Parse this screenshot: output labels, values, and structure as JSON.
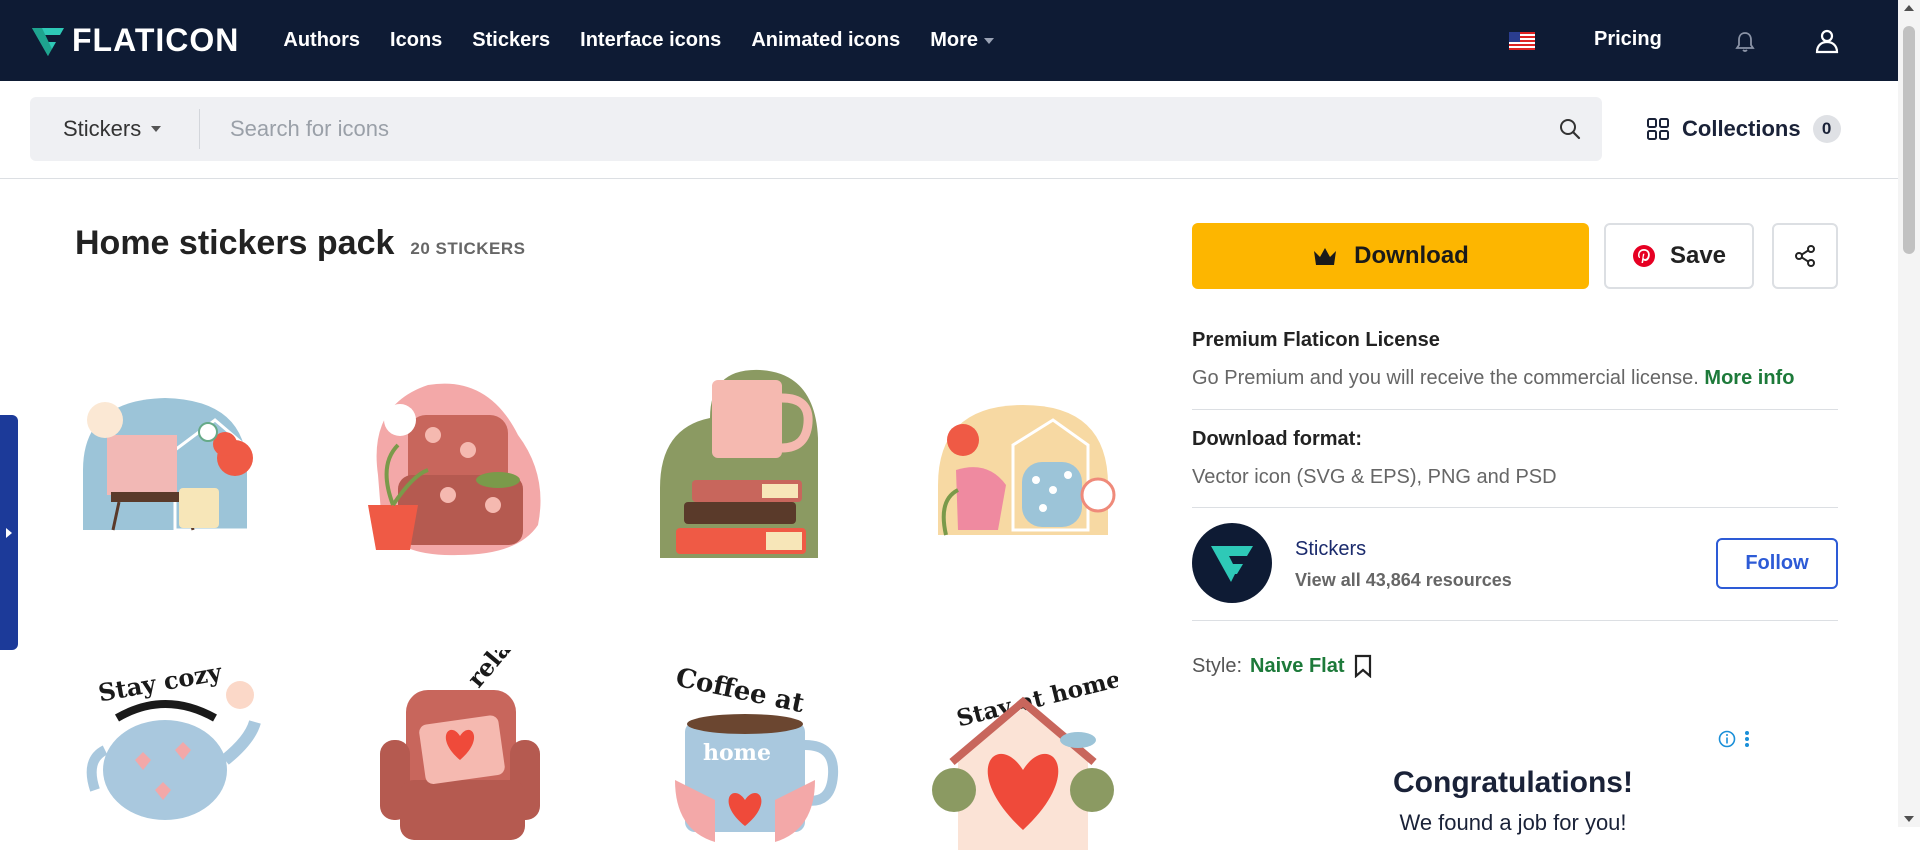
{
  "nav": {
    "logo": "FLATICON",
    "links": [
      "Authors",
      "Icons",
      "Stickers",
      "Interface icons",
      "Animated icons",
      "More"
    ],
    "pricing": "Pricing"
  },
  "search": {
    "type": "Stickers",
    "placeholder": "Search for icons"
  },
  "collections": {
    "label": "Collections",
    "count": "0"
  },
  "pack": {
    "title": "Home stickers pack",
    "count": "20 STICKERS",
    "stickers": [
      {
        "name": "home-interior-sticker",
        "text": ""
      },
      {
        "name": "armchair-plant-sticker",
        "text": ""
      },
      {
        "name": "books-mug-sticker",
        "text": ""
      },
      {
        "name": "watering-can-sticker",
        "text": ""
      },
      {
        "name": "stay-cozy-sticker",
        "text": "Stay cozy"
      },
      {
        "name": "time-to-relax-sticker",
        "text": "Time to relax"
      },
      {
        "name": "coffee-at-home-sticker",
        "text": "Coffee at"
      },
      {
        "name": "stay-at-home-sticker",
        "text": "Stay at home"
      }
    ]
  },
  "actions": {
    "download": "Download",
    "save": "Save"
  },
  "license": {
    "title": "Premium Flaticon License",
    "text": "Go Premium and you will receive the commercial license.",
    "link": "More info"
  },
  "format": {
    "title": "Download format:",
    "text": "Vector icon (SVG & EPS), PNG and PSD"
  },
  "author": {
    "name": "Stickers",
    "resources": "View all 43,864 resources",
    "follow": "Follow"
  },
  "style": {
    "label": "Style:",
    "value": "Naive Flat"
  },
  "ad": {
    "title": "Congratulations!",
    "subtitle": "We found a job for you!"
  },
  "colors": {
    "nav_bg": "#0e1b34",
    "download": "#fdb600",
    "accent_green": "#1d7a3a",
    "follow_blue": "#2d5bd6"
  }
}
